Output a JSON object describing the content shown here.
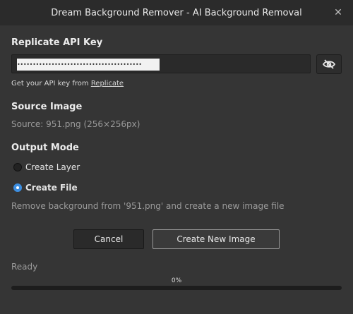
{
  "window": {
    "title": "Dream Background Remover - AI Background Removal",
    "close_glyph": "✕"
  },
  "api": {
    "label": "Replicate API Key",
    "masked_value": "••••••••••••••••••••••••••••••••••••••••",
    "toggle_icon": "eye-slash-icon",
    "help_prefix": "Get your API key from ",
    "help_link": "Replicate"
  },
  "source": {
    "label": "Source Image",
    "text": "Source: 951.png (256×256px)"
  },
  "output": {
    "label": "Output Mode",
    "options": [
      {
        "label": "Create Layer",
        "selected": false
      },
      {
        "label": "Create File",
        "selected": true
      }
    ],
    "description": "Remove background from '951.png' and create a new image file"
  },
  "buttons": {
    "cancel": "Cancel",
    "create": "Create New Image"
  },
  "status": {
    "text": "Ready",
    "progress_label": "0%",
    "progress_fraction": 0
  },
  "colors": {
    "accent": "#3d8ee0",
    "background": "#353535"
  }
}
